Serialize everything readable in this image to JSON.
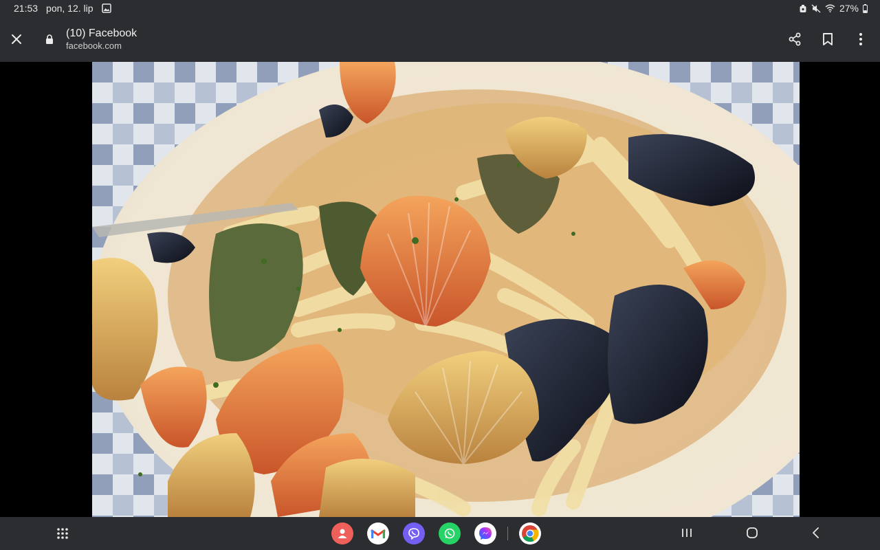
{
  "status_bar": {
    "time": "21:53",
    "date": "pon, 12. lip",
    "battery": "27%",
    "icons": [
      "gallery-icon",
      "alarm-icon",
      "mute-icon",
      "wifi-icon",
      "battery-icon"
    ]
  },
  "browser": {
    "title": "(10) Facebook",
    "url": "facebook.com",
    "icons": [
      "close-icon",
      "lock-icon",
      "share-icon",
      "bookmark-icon",
      "more-vert-icon"
    ]
  },
  "content": {
    "image_icon": "seafood-pasta-photo"
  },
  "nav_bar": {
    "dock_apps": [
      "contacts-app-icon",
      "gmail-app-icon",
      "viber-app-icon",
      "whatsapp-app-icon",
      "messenger-app-icon",
      "chrome-app-icon"
    ],
    "colors": {
      "contacts": "#f0605a",
      "viber": "#7360f2",
      "whatsapp": "#25d366",
      "messenger": "#8b5cf6",
      "bar": "#2b2d30"
    }
  }
}
